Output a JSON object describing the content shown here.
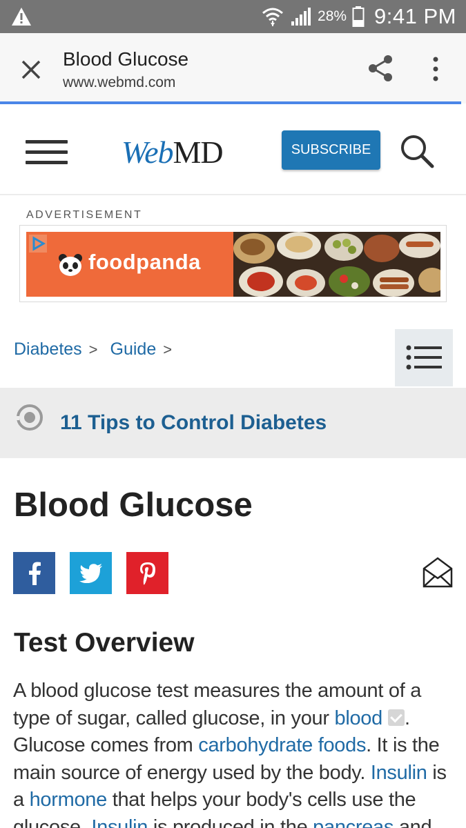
{
  "status_bar": {
    "battery_percent": "28%",
    "time": "9:41 PM"
  },
  "custom_tab": {
    "title": "Blood Glucose",
    "url": "www.webmd.com"
  },
  "site_header": {
    "logo_web": "Web",
    "logo_md": "MD",
    "subscribe_label": "SUBSCRIBE"
  },
  "ad": {
    "label": "ADVERTISEMENT",
    "brand": "foodpanda"
  },
  "breadcrumb": {
    "items": [
      {
        "label": "Diabetes",
        "separator": ">"
      },
      {
        "label": "Guide",
        "separator": ">"
      }
    ]
  },
  "promo": {
    "link_text": "11 Tips to Control Diabetes"
  },
  "article": {
    "title": "Blood Glucose",
    "section_heading": "Test Overview",
    "paragraph": [
      {
        "text": "A blood glucose test measures the amount of a type of sugar, called glucose, in your ",
        "link": false
      },
      {
        "text": "blood",
        "link": true
      },
      {
        "text": ". Glucose comes from ",
        "link": false
      },
      {
        "text": "carbohydrate foods",
        "link": true
      },
      {
        "text": ". It is the main source of energy used by the body. ",
        "link": false
      },
      {
        "text": "Insulin",
        "link": true
      },
      {
        "text": " is a ",
        "link": false
      },
      {
        "text": "hormone",
        "link": true
      },
      {
        "text": " that helps your body's cells use the glucose. ",
        "link": false
      },
      {
        "text": "Insulin",
        "link": true
      },
      {
        "text": " is produced in the ",
        "link": false
      },
      {
        "text": "pancreas",
        "link": true
      },
      {
        "text": " and",
        "link": false
      }
    ]
  },
  "colors": {
    "accent_blue": "#1f6aa5",
    "subscribe_blue": "#1f77b4",
    "facebook": "#2f5d9e",
    "twitter": "#1da1d8",
    "pinterest": "#e0212a",
    "ad_orange": "#ef6a3a"
  }
}
